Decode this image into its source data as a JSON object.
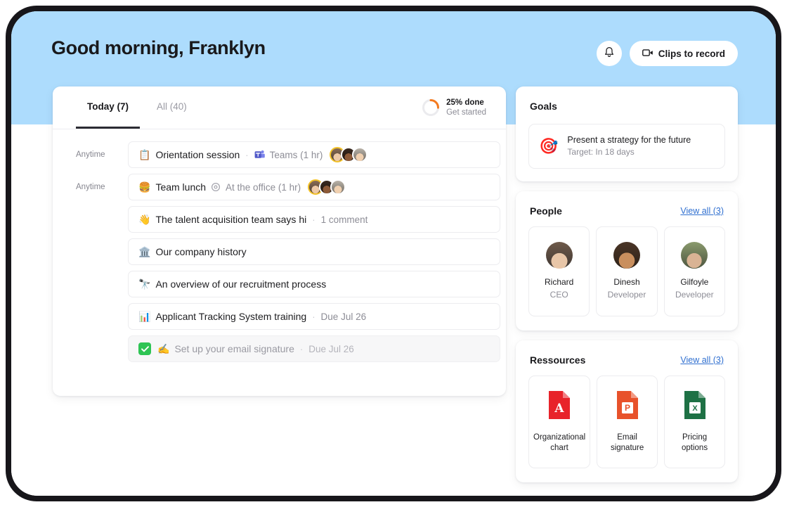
{
  "header": {
    "greeting": "Good morning, Franklyn",
    "notifications_icon": "bell-icon",
    "clips_button": "Clips to record",
    "clips_icon": "video-camera-icon"
  },
  "tasks_panel": {
    "tabs": [
      {
        "label": "Today (7)",
        "active": true
      },
      {
        "label": "All (40)",
        "active": false
      }
    ],
    "progress": {
      "percent": 25,
      "primary": "25% done",
      "secondary": "Get started",
      "color": "#f47b20",
      "track_color": "#ebebee"
    },
    "rows": [
      {
        "when": "Anytime",
        "emoji": "📋",
        "emoji_name": "clipboard-emoji",
        "title": "Orientation session",
        "separator": "·",
        "meta_icon": "microsoft-teams-icon",
        "meta": "Teams (1 hr)",
        "avatars": [
          "av-a",
          "av-b",
          "av-c"
        ],
        "done": false
      },
      {
        "when": "Anytime",
        "emoji": "🍔",
        "emoji_name": "hamburger-emoji",
        "title": "Team lunch",
        "separator": "",
        "meta_icon": "location-pin-icon",
        "meta": "At the office (1 hr)",
        "avatars": [
          "av-a",
          "av-b",
          "av-c"
        ],
        "done": false
      },
      {
        "when": "",
        "emoji": "👋",
        "emoji_name": "waving-hand-emoji",
        "title": "The talent acquisition team says hi",
        "separator": "·",
        "meta_icon": "",
        "meta": "1 comment",
        "avatars": [],
        "done": false
      },
      {
        "when": "",
        "emoji": "🏛️",
        "emoji_name": "classical-building-emoji",
        "title": "Our company history",
        "separator": "",
        "meta_icon": "",
        "meta": "",
        "avatars": [],
        "done": false
      },
      {
        "when": "",
        "emoji": "🔭",
        "emoji_name": "telescope-emoji",
        "title": "An overview of our recruitment process",
        "separator": "",
        "meta_icon": "",
        "meta": "",
        "avatars": [],
        "done": false
      },
      {
        "when": "",
        "emoji": "📊",
        "emoji_name": "bar-chart-emoji",
        "title": "Applicant Tracking System training",
        "separator": "·",
        "meta_icon": "",
        "meta": "Due Jul 26",
        "avatars": [],
        "done": false
      },
      {
        "when": "",
        "emoji": "✍️",
        "emoji_name": "writing-hand-emoji",
        "title": "Set up your email signature",
        "separator": "·",
        "meta_icon": "",
        "meta": "Due Jul 26",
        "avatars": [],
        "done": true
      }
    ]
  },
  "goals": {
    "title": "Goals",
    "item": {
      "emoji": "🎯",
      "emoji_name": "dart-target-emoji",
      "title": "Present a strategy for the future",
      "target": "Target: In 18 days"
    }
  },
  "people": {
    "title": "People",
    "view_all": "View all (3)",
    "members": [
      {
        "name": "Richard",
        "role": "CEO",
        "avatar": "av-richard"
      },
      {
        "name": "Dinesh",
        "role": "Developer",
        "avatar": "av-dinesh"
      },
      {
        "name": "Gilfoyle",
        "role": "Developer",
        "avatar": "av-gilfoyle"
      }
    ]
  },
  "resources": {
    "title": "Ressources",
    "view_all": "View all (3)",
    "files": [
      {
        "name": "Organizational chart",
        "type": "pdf",
        "icon": "pdf-file-icon",
        "color": "#e8232a"
      },
      {
        "name": "Email signature",
        "type": "pptx",
        "icon": "powerpoint-file-icon",
        "color": "#e8522b"
      },
      {
        "name": "Pricing options",
        "type": "xlsx",
        "icon": "excel-file-icon",
        "color": "#1e7145"
      }
    ]
  },
  "theme": {
    "background_blue": "#addcfd",
    "bezel": "#17161a",
    "accent_link": "#2f6fd0",
    "done_green": "#2ec454"
  }
}
